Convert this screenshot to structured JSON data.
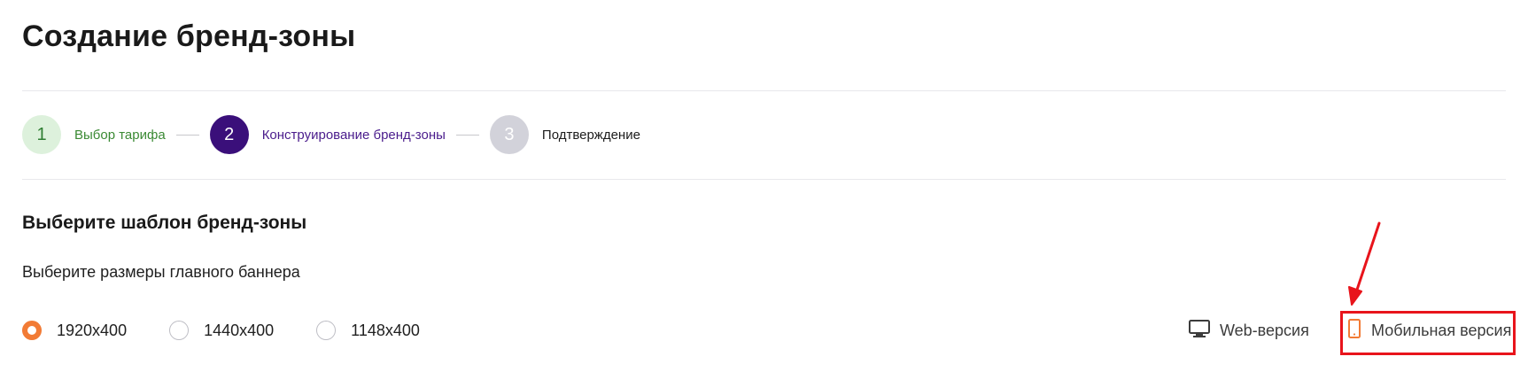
{
  "page": {
    "title": "Создание бренд-зоны"
  },
  "stepper": {
    "steps": [
      {
        "number": "1",
        "label": "Выбор тарифа",
        "state": "done"
      },
      {
        "number": "2",
        "label": "Конструирование бренд-зоны",
        "state": "active"
      },
      {
        "number": "3",
        "label": "Подтверждение",
        "state": "pending"
      }
    ]
  },
  "section": {
    "title": "Выберите шаблон бренд-зоны",
    "subtitle": "Выберите размеры главного баннера"
  },
  "banner_sizes": {
    "options": [
      {
        "label": "1920x400",
        "selected": true
      },
      {
        "label": "1440x400",
        "selected": false
      },
      {
        "label": "1148x400",
        "selected": false
      }
    ]
  },
  "view_toggle": {
    "web_label": "Web-версия",
    "web_icon": "monitor-icon",
    "mobile_label": "Мобильная версия",
    "mobile_icon": "smartphone-icon",
    "active": "mobile"
  },
  "colors": {
    "accent_orange": "#f27b35",
    "step_active": "#3a0f7a",
    "step_done_bg": "#ddf1dc",
    "annotation_red": "#e8141b"
  }
}
